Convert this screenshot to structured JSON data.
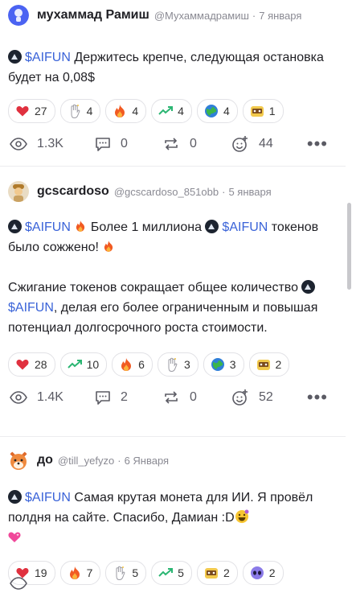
{
  "posts": [
    {
      "author": "мухаммад Рамиш",
      "handle": "@Мухаммадрамиш",
      "sep": "·",
      "date": "7 января",
      "text_1": "Держитесь крепче, следующая остановка будет на 0,08$",
      "ticker": "$AIFUN",
      "reactions": [
        {
          "icon": "heart-icon",
          "count": "27"
        },
        {
          "icon": "hand-icon",
          "count": "4"
        },
        {
          "icon": "fire-icon",
          "count": "4"
        },
        {
          "icon": "trend-up-icon",
          "count": "4"
        },
        {
          "icon": "globe-icon",
          "count": "4"
        },
        {
          "icon": "badge-icon",
          "count": "1"
        }
      ],
      "views": "1.3K",
      "comments": "0",
      "reposts": "0",
      "likes": "44",
      "more": "•••"
    },
    {
      "author": "gcscardoso",
      "handle": "@gcscardoso_851obb",
      "sep": "·",
      "date": "5 января",
      "ticker": "$AIFUN",
      "text_a": "Более 1 миллиона",
      "text_b": "токенов было сожжено!",
      "text_c": "Сжигание токенов сокращает общее количество",
      "text_d": ", делая его более ограниченным и повышая потенциал долгосрочного роста стоимости.",
      "reactions": [
        {
          "icon": "heart-icon",
          "count": "28"
        },
        {
          "icon": "trend-up-icon",
          "count": "10"
        },
        {
          "icon": "fire-icon",
          "count": "6"
        },
        {
          "icon": "hand-icon",
          "count": "3"
        },
        {
          "icon": "globe-icon",
          "count": "3"
        },
        {
          "icon": "badge-icon",
          "count": "2"
        }
      ],
      "views": "1.4K",
      "comments": "2",
      "reposts": "0",
      "likes": "52",
      "more": "•••"
    },
    {
      "author": "до",
      "handle": "@till_yefyzo",
      "sep": "·",
      "date": "6 Января",
      "ticker": "$AIFUN",
      "text_1": "Самая крутая монета для ИИ. Я провёл полдня на сайте. Спасибо, Дамиан :D",
      "reactions": [
        {
          "icon": "heart-icon",
          "count": "19"
        },
        {
          "icon": "fire-icon",
          "count": "7"
        },
        {
          "icon": "hand-icon",
          "count": "5"
        },
        {
          "icon": "trend-up-icon",
          "count": "5"
        },
        {
          "icon": "badge-icon",
          "count": "2"
        },
        {
          "icon": "alien-icon",
          "count": "2"
        }
      ]
    }
  ]
}
